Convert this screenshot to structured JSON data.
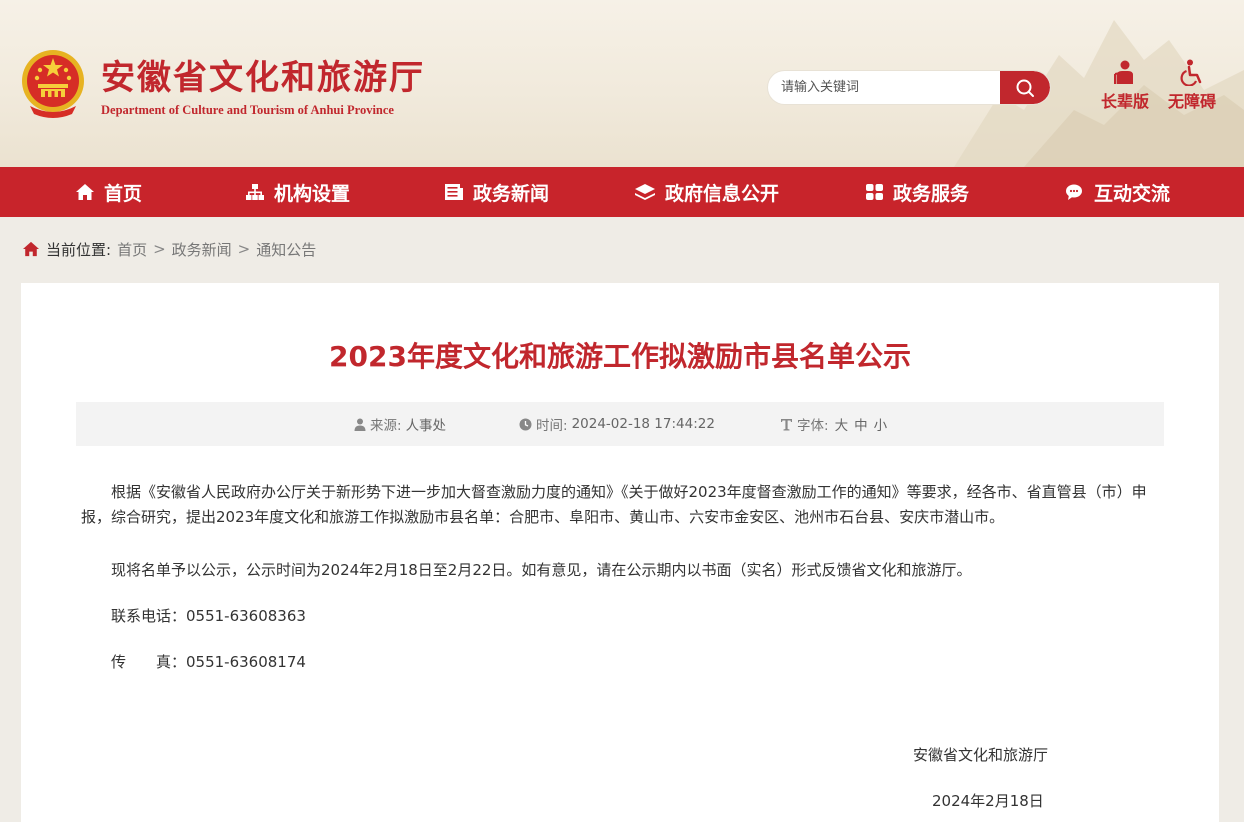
{
  "header": {
    "site_title": "安徽省文化和旅游厅",
    "site_subtitle": "Department of Culture and Tourism of Anhui Province",
    "search_placeholder": "请输入关键词",
    "tools": [
      {
        "label": "长辈版",
        "icon": "elder-icon"
      },
      {
        "label": "无障碍",
        "icon": "wheelchair-icon"
      }
    ]
  },
  "nav": {
    "items": [
      {
        "label": "首页",
        "icon": "home-icon"
      },
      {
        "label": "机构设置",
        "icon": "org-chart-icon"
      },
      {
        "label": "政务新闻",
        "icon": "news-icon"
      },
      {
        "label": "政府信息公开",
        "icon": "layers-icon"
      },
      {
        "label": "政务服务",
        "icon": "grid-icon"
      },
      {
        "label": "互动交流",
        "icon": "chat-icon"
      }
    ]
  },
  "breadcrumb": {
    "lead": "当前位置:",
    "items": [
      "首页",
      "政务新闻",
      "通知公告"
    ],
    "separator": ">"
  },
  "article": {
    "title": "2023年度文化和旅游工作拟激励市县名单公示",
    "meta": {
      "source_label": "来源:",
      "source_value": "人事处",
      "time_label": "时间:",
      "time_value": "2024-02-18 17:44:22",
      "font_label": "字体:",
      "font_sizes": [
        "大",
        "中",
        "小"
      ]
    },
    "paragraphs": [
      "根据《安徽省人民政府办公厅关于新形势下进一步加大督查激励力度的通知》《关于做好2023年度督查激励工作的通知》等要求，经各市、省直管县（市）申报，综合研究，提出2023年度文化和旅游工作拟激励市县名单：合肥市、阜阳市、黄山市、六安市金安区、池州市石台县、安庆市潜山市。",
      "现将名单予以公示，公示时间为2024年2月18日至2月22日。如有意见，请在公示期内以书面（实名）形式反馈省文化和旅游厅。",
      "联系电话：0551-63608363",
      "传　　真：0551-63608174"
    ],
    "signature": "安徽省文化和旅游厅",
    "date": "2024年2月18日"
  },
  "colors": {
    "brand_red": "#c8242b",
    "title_red": "#c1272d",
    "header_bg": "#f3ede1"
  }
}
